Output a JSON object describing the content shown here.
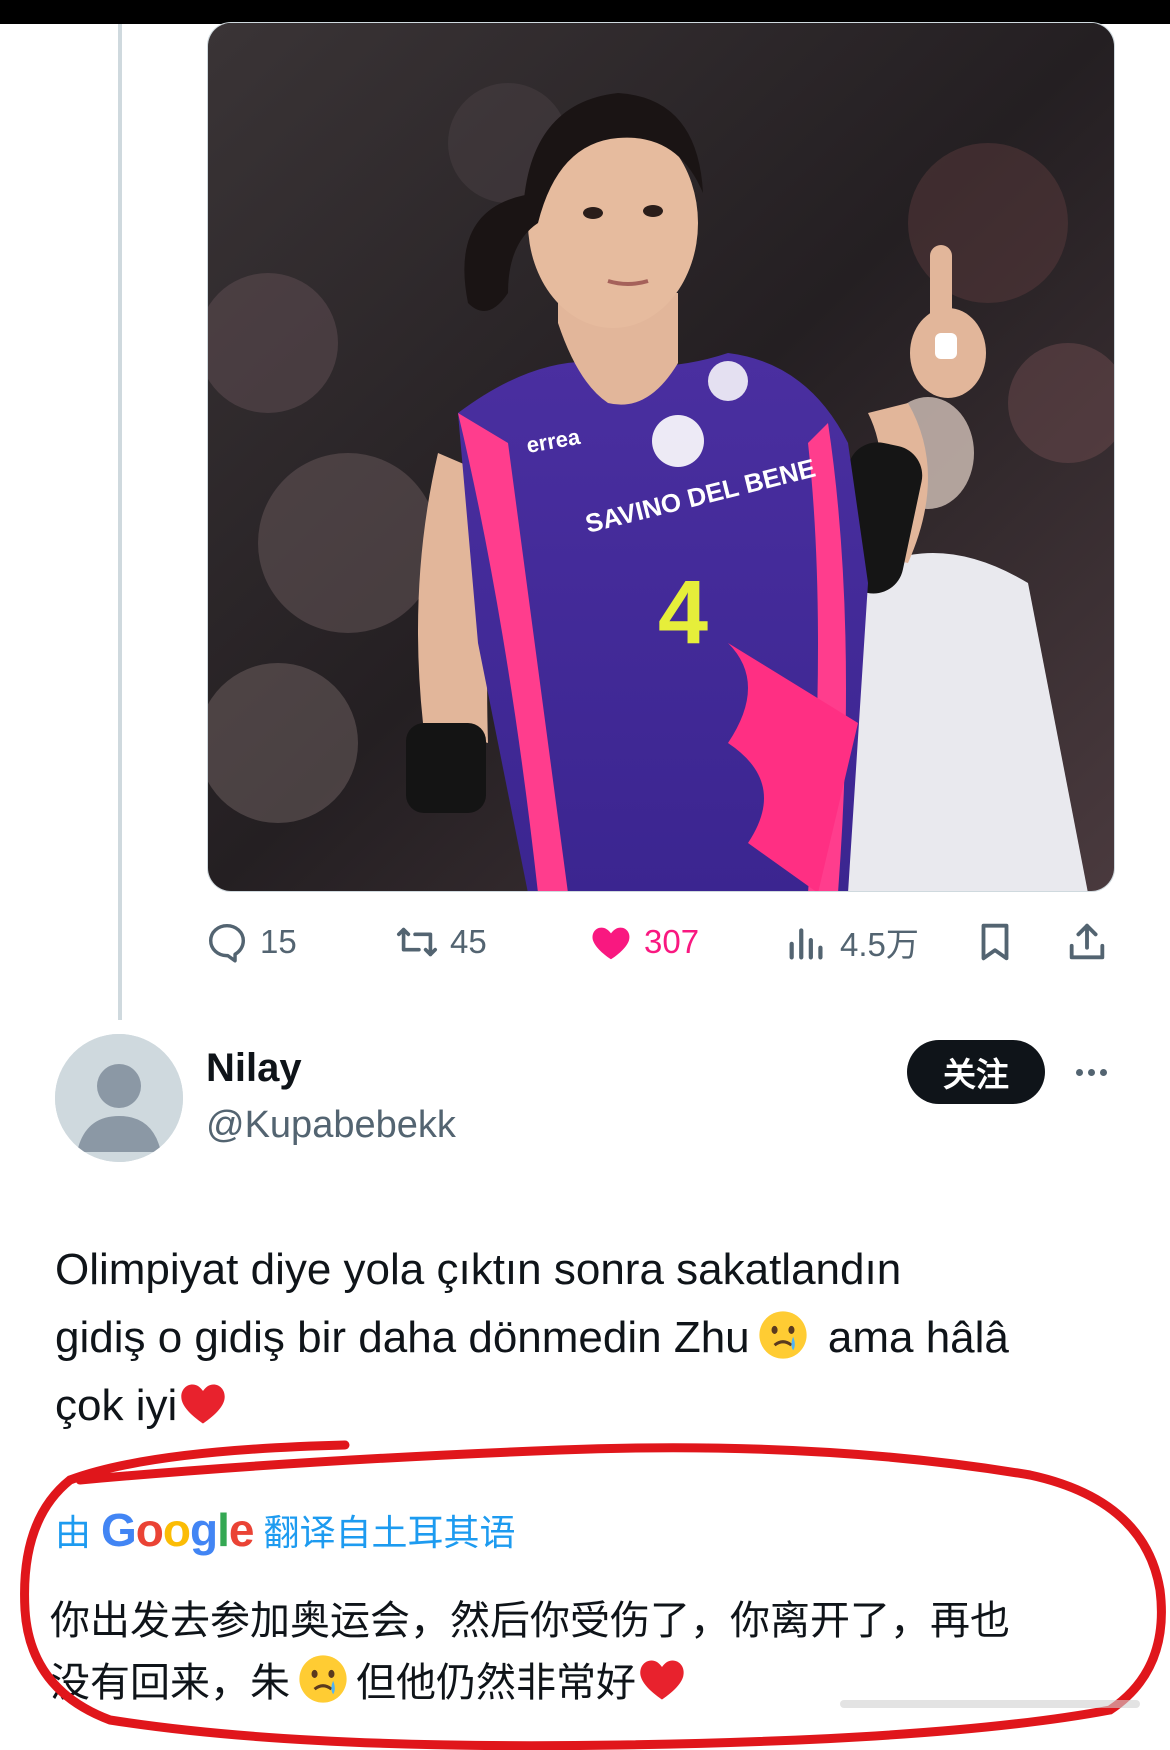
{
  "tweet": {
    "media": {
      "alt_description": "",
      "jersey_sponsor": "SAVINO DEL BENE",
      "jersey_brand": "errea",
      "jersey_number": "4"
    },
    "actions": {
      "replies": "15",
      "retweets": "45",
      "likes": "307",
      "views": "4.5万"
    }
  },
  "reply": {
    "display_name": "Nilay",
    "handle": "@Kupabebekk",
    "follow_label": "关注",
    "text_line1": "Olimpiyat diye yola çıktın sonra sakatlandın",
    "text_line2a": "gidiş o gidiş bir daha dönmedin Zhu",
    "text_line2b": " ama hâlâ",
    "text_line3": "çok iyi",
    "translation": {
      "prefix": "由",
      "provider": "Google",
      "suffix": "翻译自土耳其语",
      "line1": "你出发去参加奥运会，然后你受伤了，你离开了，再也",
      "line2a": "没有回来，朱",
      "line2b": "但他仍然非常好"
    }
  },
  "colors": {
    "accent": "#1d9bf0",
    "like": "#f91880",
    "annotation": "#e0161b",
    "text_secondary": "#536471"
  },
  "icons": [
    "reply-icon",
    "retweet-icon",
    "like-icon",
    "views-icon",
    "bookmark-icon",
    "share-icon",
    "more-icon",
    "crying-face-icon",
    "red-heart-icon"
  ]
}
